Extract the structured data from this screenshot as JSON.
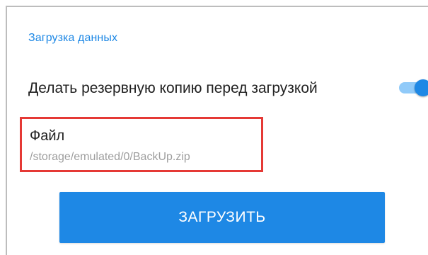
{
  "section": {
    "title": "Загрузка данных"
  },
  "backup_toggle": {
    "label": "Делать резервную копию перед загрузкой",
    "state": "on"
  },
  "file": {
    "label": "Файл",
    "path": "/storage/emulated/0/BackUp.zip",
    "highlight_color": "#e53935"
  },
  "upload_button": {
    "label": "ЗАГРУЗИТЬ"
  },
  "colors": {
    "accent": "#1e88e5",
    "toggle_track": "#90caf9",
    "text_primary": "#212121",
    "text_secondary": "#9e9e9e"
  }
}
